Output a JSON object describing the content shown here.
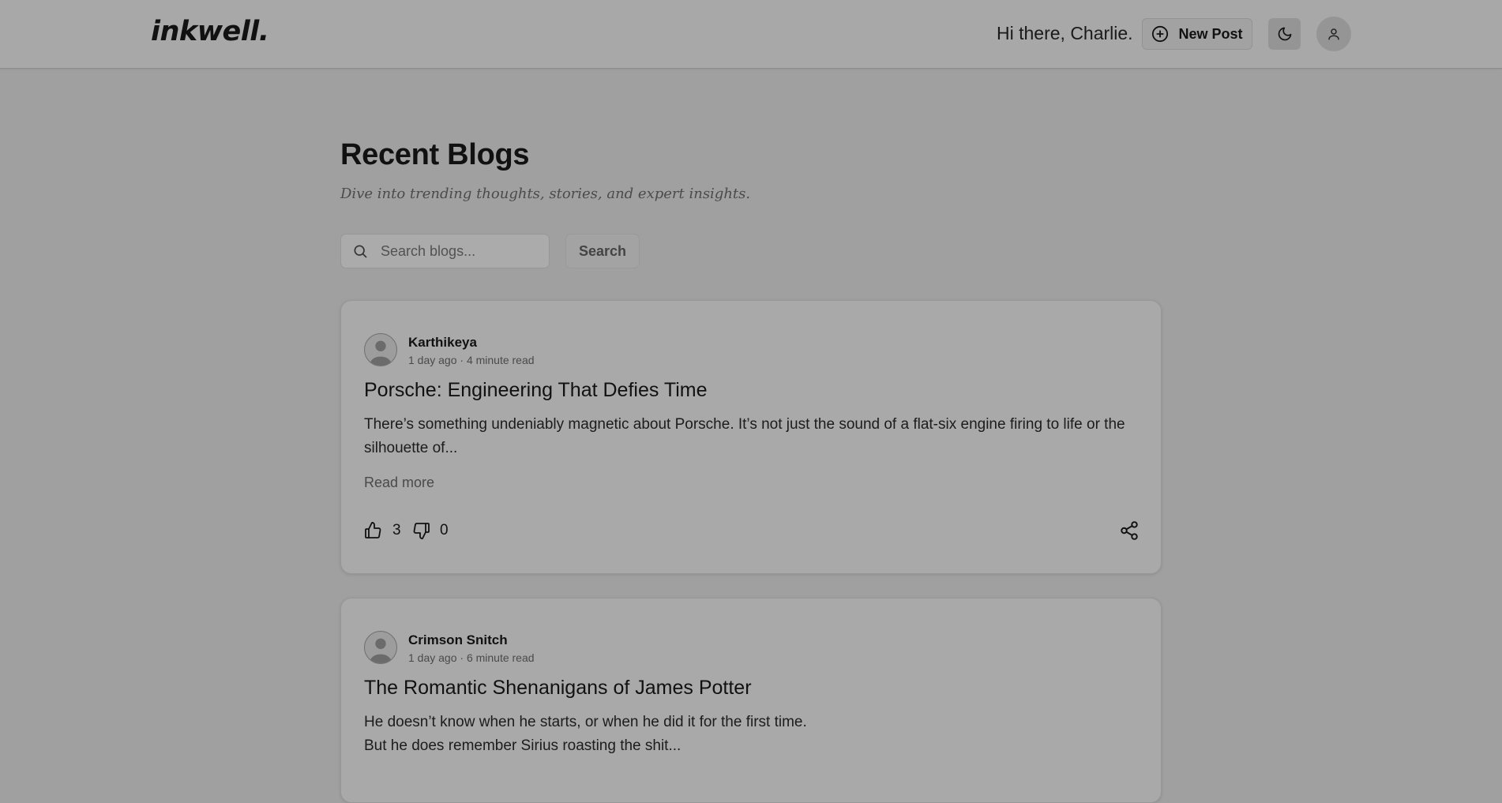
{
  "header": {
    "logo": "inkwell.",
    "greeting": "Hi there, Charlie.",
    "new_post_label": "New Post",
    "icons": {
      "new_post": "plus-circle-icon",
      "theme": "moon-icon",
      "profile": "user-icon"
    }
  },
  "main": {
    "title": "Recent Blogs",
    "subtitle": "Dive into trending thoughts, stories, and expert insights.",
    "search": {
      "placeholder": "Search blogs...",
      "value": "",
      "button_label": "Search",
      "icon": "search-icon"
    }
  },
  "posts": [
    {
      "author": "Karthikeya",
      "meta": "1 day ago · 4 minute read",
      "title": "Porsche: Engineering That Defies Time",
      "excerpt": "There’s something undeniably magnetic about Porsche. It’s not just the sound of a flat-six engine firing to life or the silhouette of...",
      "read_more": "Read more",
      "likes": "3",
      "dislikes": "0"
    },
    {
      "author": "Crimson Snitch",
      "meta": "1 day ago · 6 minute read",
      "title": "The Romantic Shenanigans of James Potter",
      "excerpt": "He doesn’t know when he starts, or when he did it for the first time.\nBut he does remember Sirius roasting the shit..."
    }
  ],
  "colors": {
    "overlay_background": "#a0a0a0",
    "card_background": "#a9a9a9",
    "text_primary": "#111111",
    "text_muted": "#4a4a4a"
  }
}
